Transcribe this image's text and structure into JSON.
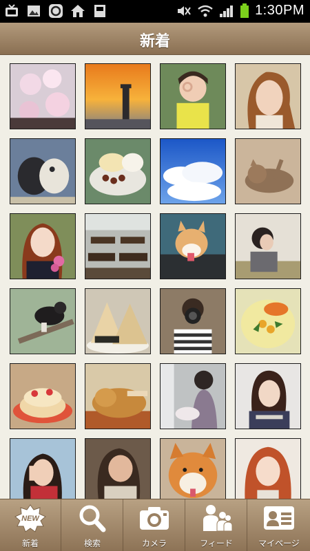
{
  "status_bar": {
    "time": "1:30PM"
  },
  "header": {
    "title": "新着"
  },
  "photos": [
    {
      "name": "cherry-blossom-photo"
    },
    {
      "name": "sunset-lighthouse-photo"
    },
    {
      "name": "girl-ok-gesture-photo"
    },
    {
      "name": "woman-portrait-photo"
    },
    {
      "name": "kittens-photo"
    },
    {
      "name": "dessert-photo"
    },
    {
      "name": "blue-sky-clouds-photo"
    },
    {
      "name": "tabby-cat-lying-photo"
    },
    {
      "name": "girl-sailor-uniform-photo"
    },
    {
      "name": "classroom-desks-photo"
    },
    {
      "name": "dog-car-window-photo"
    },
    {
      "name": "girl-field-photo"
    },
    {
      "name": "cat-on-tree-photo"
    },
    {
      "name": "onigiri-photo"
    },
    {
      "name": "child-camera-photo"
    },
    {
      "name": "soup-dish-photo"
    },
    {
      "name": "pancakes-photo"
    },
    {
      "name": "sleeping-dog-photo"
    },
    {
      "name": "kimono-woman-photo"
    },
    {
      "name": "woman-short-hair-photo"
    },
    {
      "name": "woman-red-scarf-photo"
    },
    {
      "name": "woman-smiling-photo"
    },
    {
      "name": "shiba-dog-photo"
    },
    {
      "name": "woman-redhead-photo"
    }
  ],
  "tabs": [
    {
      "label": "新着",
      "icon": "new-badge-icon"
    },
    {
      "label": "検索",
      "icon": "search-icon"
    },
    {
      "label": "カメラ",
      "icon": "camera-icon"
    },
    {
      "label": "フィード",
      "icon": "people-icon"
    },
    {
      "label": "マイページ",
      "icon": "profile-card-icon"
    }
  ],
  "tab_badge_text": "NEW",
  "colors": {
    "header": "#9c8262",
    "background": "#f1efe6",
    "tabbar": "#a48a6c"
  }
}
